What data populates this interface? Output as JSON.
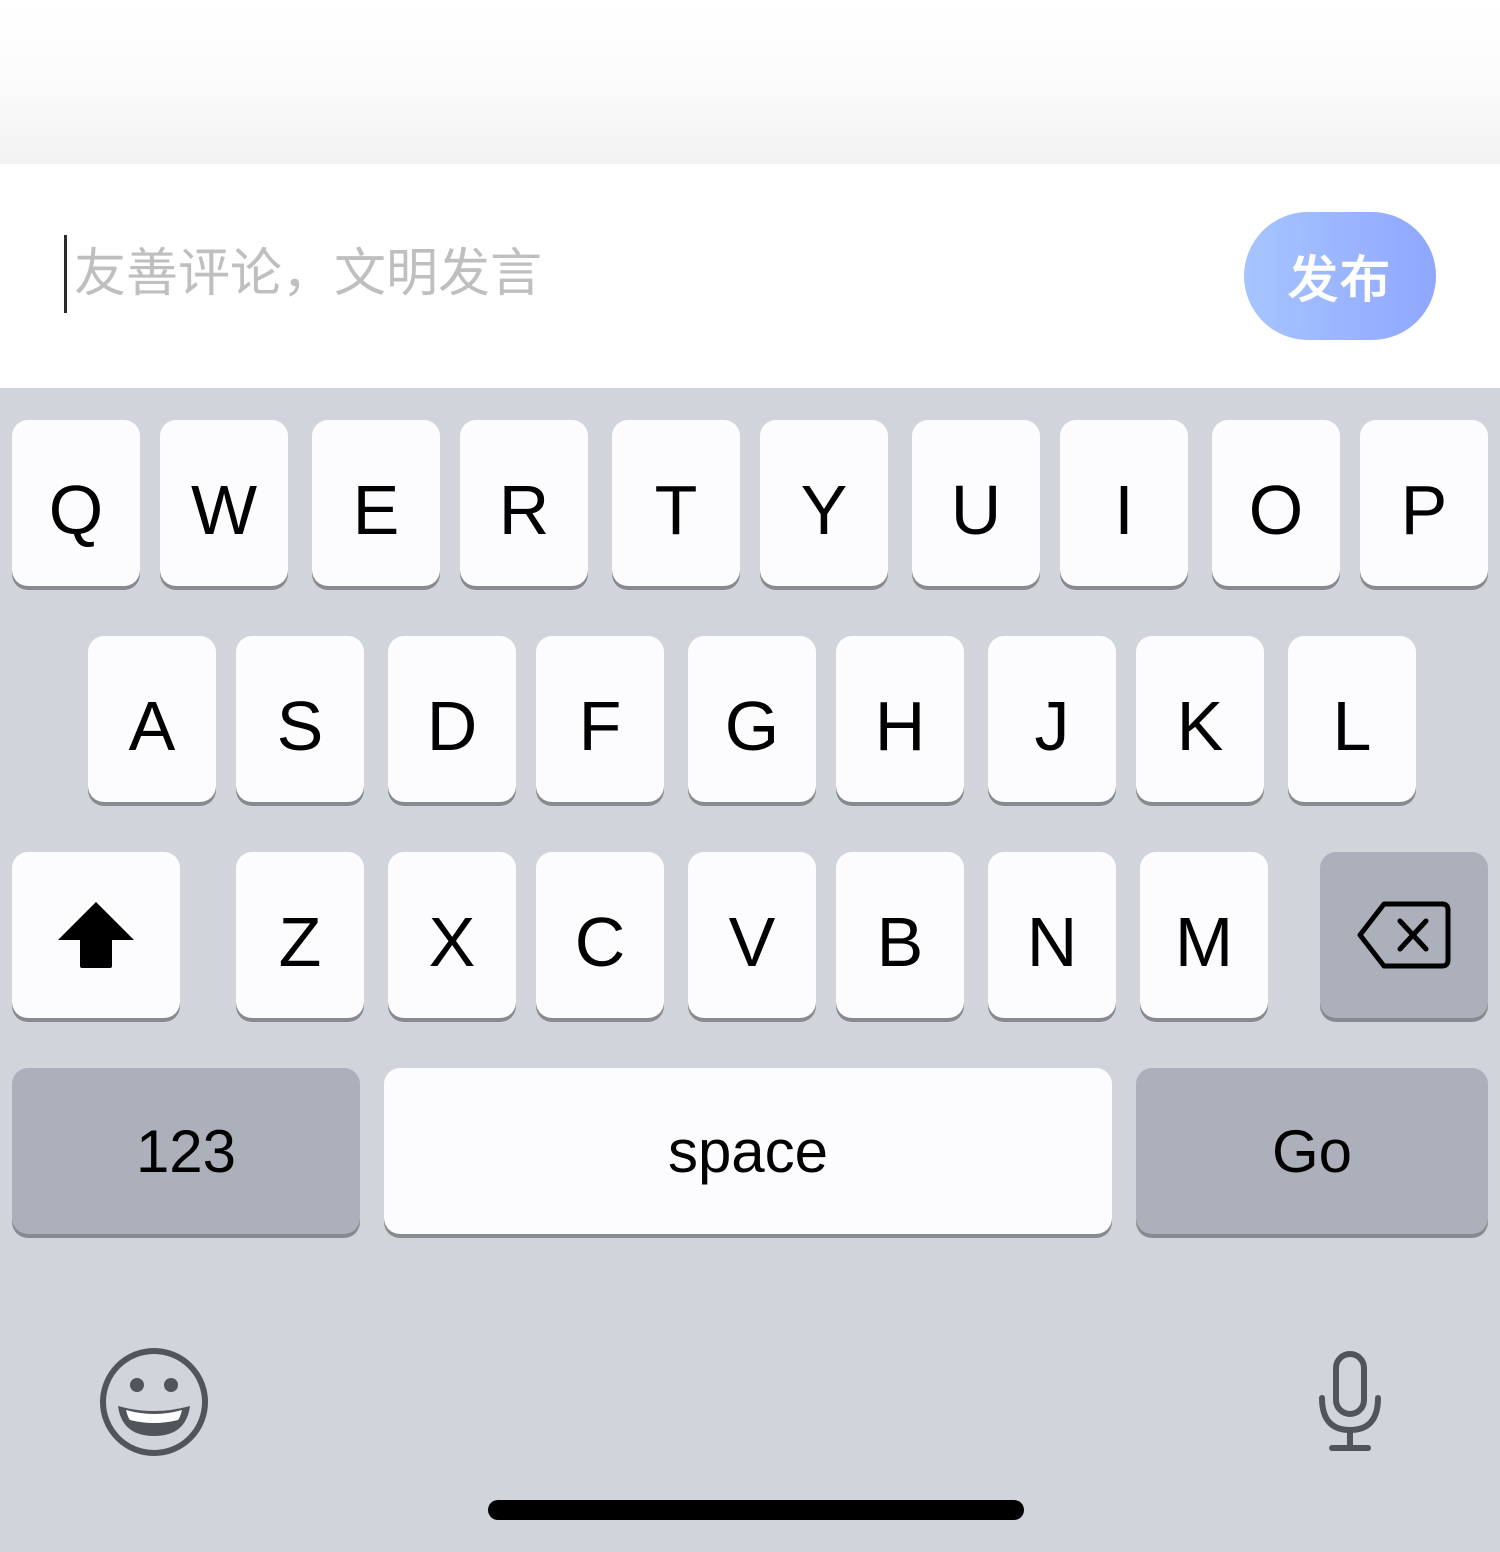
{
  "comment": {
    "placeholder": "友善评论，文明发言",
    "value": "",
    "publish_label": "发布",
    "publish_gradient": [
      "#a6c6ff",
      "#90a6ff"
    ]
  },
  "keyboard": {
    "row1": [
      "Q",
      "W",
      "E",
      "R",
      "T",
      "Y",
      "U",
      "I",
      "O",
      "P"
    ],
    "row2": [
      "A",
      "S",
      "D",
      "F",
      "G",
      "H",
      "J",
      "K",
      "L"
    ],
    "row3": [
      "Z",
      "X",
      "C",
      "V",
      "B",
      "N",
      "M"
    ],
    "shift_icon": "shift-arrow-icon",
    "delete_icon": "backspace-icon",
    "numbers_label": "123",
    "space_label": "space",
    "go_label": "Go",
    "emoji_icon": "emoji-smile-icon",
    "mic_icon": "microphone-icon",
    "background_color": "#d1d4db",
    "key_color": "#fcfcfe",
    "function_key_color": "#abb0ba"
  }
}
